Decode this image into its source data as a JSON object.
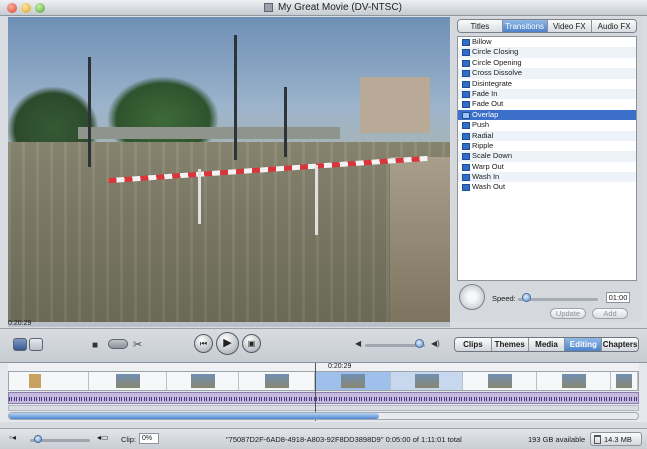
{
  "window": {
    "title": "My Great Movie (DV-NTSC)"
  },
  "viewer": {
    "timecode": "0:20:29"
  },
  "panel": {
    "tabs": [
      {
        "label": "Titles",
        "active": false
      },
      {
        "label": "Transitions",
        "active": true
      },
      {
        "label": "Video FX",
        "active": false
      },
      {
        "label": "Audio FX",
        "active": false
      }
    ],
    "transitions": [
      "Billow",
      "Circle Closing",
      "Circle Opening",
      "Cross Dissolve",
      "Disintegrate",
      "Fade In",
      "Fade Out",
      "Overlap",
      "Push",
      "Radial",
      "Ripple",
      "Scale Down",
      "Warp Out",
      "Wash In",
      "Wash Out"
    ],
    "selected_transition": "Overlap",
    "speed_label": "Speed:",
    "speed_value": "01:00",
    "speed_level_fraction": 0.1,
    "update_label": "Update",
    "add_label": "Add"
  },
  "controls": {
    "pane_tabs": [
      {
        "label": "Clips",
        "active": false
      },
      {
        "label": "Themes",
        "active": false
      },
      {
        "label": "Media",
        "active": false
      },
      {
        "label": "Editing",
        "active": true
      },
      {
        "label": "Chapters",
        "active": false
      }
    ],
    "volume_level_fraction": 0.9
  },
  "timeline": {
    "playhead_time": "0:20:29"
  },
  "status": {
    "clip_label": "Clip:",
    "clip_value": "0%",
    "info": "\"75087D2F-6AD8-4918-A803-92F8DD3898D9\" 0:05:00 of 1:11:01 total",
    "disk": "193 GB available",
    "trash": "14.3 MB"
  },
  "colors": {
    "accent": "#3b6fca",
    "audio": "#c6b9de",
    "tape": "#d8363a"
  }
}
